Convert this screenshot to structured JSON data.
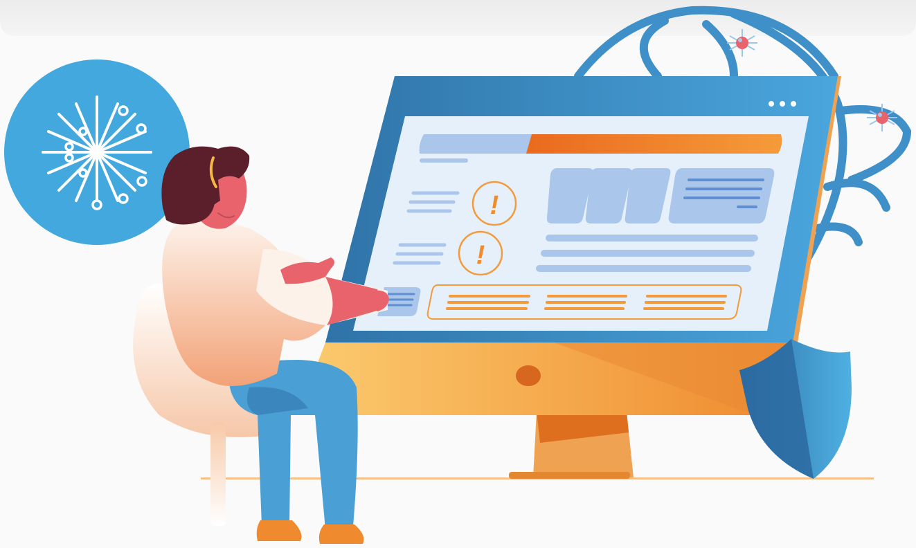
{
  "illustration": {
    "screen_dots": [
      "•",
      "•",
      "•"
    ],
    "alert_glyph": "!",
    "icons": {
      "network": "network-hub-icon",
      "globe": "globe-icon",
      "bug": "bug-icon",
      "shield": "shield-icon",
      "alert": "alert-circle-icon",
      "person": "person-illustration",
      "monitor": "monitor-illustration"
    },
    "colors": {
      "background": "#fafafa",
      "blue": "#3f9fd8",
      "dark_blue": "#2f73a8",
      "orange": "#f28b2c",
      "light_orange": "#f7b55e",
      "screen_panel": "#e6f0fb",
      "placeholder_block": "#aac6ea",
      "bug_red": "#e8636b",
      "skin": "#e8636b",
      "hair": "#5a1f2b"
    }
  }
}
